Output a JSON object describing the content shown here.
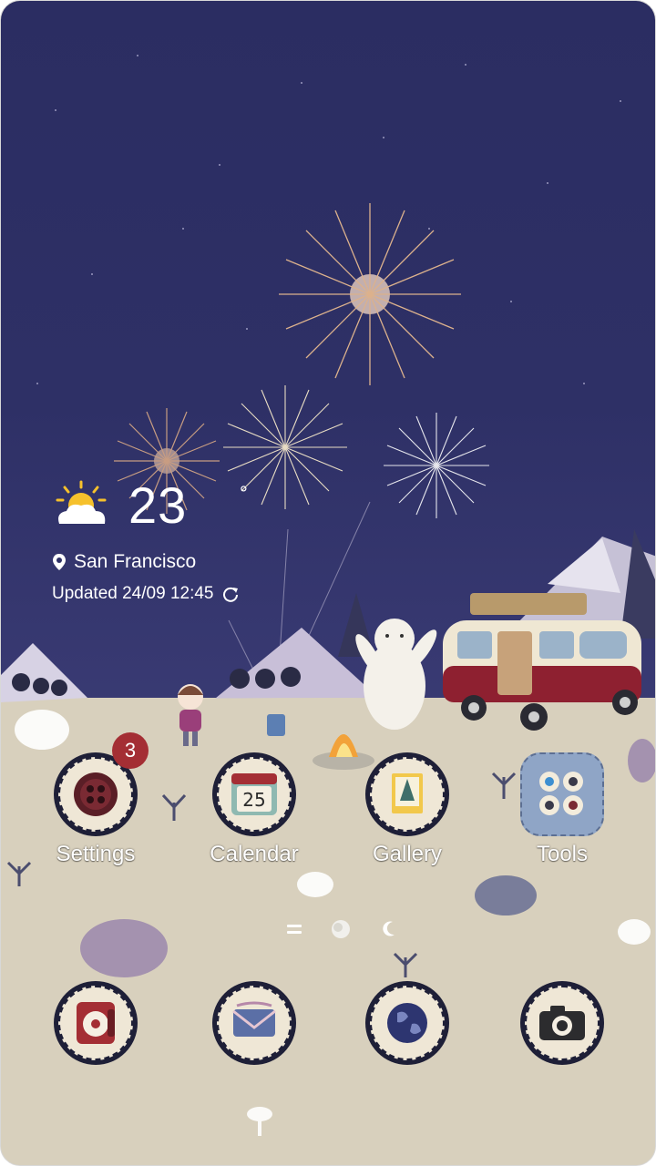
{
  "weather": {
    "temperature": "23",
    "degree_symbol": "°",
    "location": "San Francisco",
    "updated": "Updated 24/09 12:45",
    "icon": "partly-sunny-icon"
  },
  "apps": [
    {
      "label": "Settings",
      "badge": "3",
      "icon": "settings-button-icon"
    },
    {
      "label": "Calendar",
      "day": "25",
      "icon": "calendar-icon"
    },
    {
      "label": "Gallery",
      "icon": "gallery-icon"
    },
    {
      "label": "Tools",
      "icon": "folder-icon"
    }
  ],
  "dock": [
    {
      "icon": "phone-icon"
    },
    {
      "icon": "messages-icon"
    },
    {
      "icon": "internet-globe-icon"
    },
    {
      "icon": "camera-icon"
    }
  ],
  "pager": {
    "indicators": [
      "menu-lines-icon",
      "moon-dot-icon",
      "moon-crescent-icon"
    ],
    "active_index": 1
  },
  "colors": {
    "sky": "#2e3066",
    "ground": "#d8d0bd",
    "accent_red": "#a42e34",
    "ring": "#1e1f37"
  }
}
